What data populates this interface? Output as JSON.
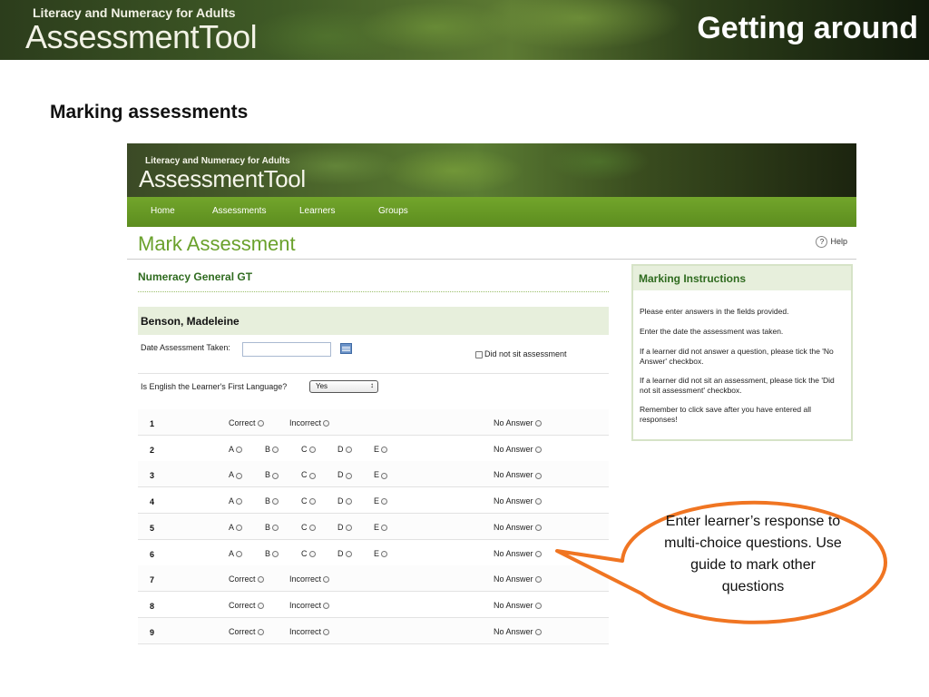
{
  "slide": {
    "banner_tagline": "Literacy and Numeracy for Adults",
    "banner_brand": "AssessmentTool",
    "section_title": "Getting around",
    "heading": "Marking assessments"
  },
  "app": {
    "banner_tagline": "Literacy and Numeracy for Adults",
    "banner_brand": "AssessmentTool",
    "nav": [
      "Home",
      "Assessments",
      "Learners",
      "Groups"
    ],
    "page_title": "Mark Assessment",
    "help_label": "Help",
    "assessment_name": "Numeracy General GT",
    "learner_name": "Benson, Madeleine",
    "date_label": "Date Assessment Taken:",
    "date_value": "",
    "did_not_sit_label": "Did not sit assessment",
    "english_label": "Is English the Learner's First Language?",
    "english_value": "Yes",
    "no_answer_label": "No Answer",
    "option_correct": "Correct",
    "option_incorrect": "Incorrect",
    "option_letters": [
      "A",
      "B",
      "C",
      "D",
      "E"
    ],
    "questions": [
      {
        "num": "1",
        "type": "ci"
      },
      {
        "num": "2",
        "type": "mc"
      },
      {
        "num": "3",
        "type": "mc"
      },
      {
        "num": "4",
        "type": "mc"
      },
      {
        "num": "5",
        "type": "mc"
      },
      {
        "num": "6",
        "type": "mc"
      },
      {
        "num": "7",
        "type": "ci"
      },
      {
        "num": "8",
        "type": "ci"
      },
      {
        "num": "9",
        "type": "ci"
      }
    ],
    "instructions_title": "Marking Instructions",
    "instructions": [
      "Please enter answers in the fields provided.",
      "Enter the date the assessment was taken.",
      "If a learner did not answer a question, please tick the 'No Answer' checkbox.",
      "If a learner did not sit an assessment, please tick the 'Did not sit assessment' checkbox.",
      "Remember to click save after you have entered all responses!"
    ]
  },
  "callout": {
    "text": "Enter learner’s response to multi-choice questions.  Use guide to mark other questions",
    "border_color": "#f07522"
  }
}
